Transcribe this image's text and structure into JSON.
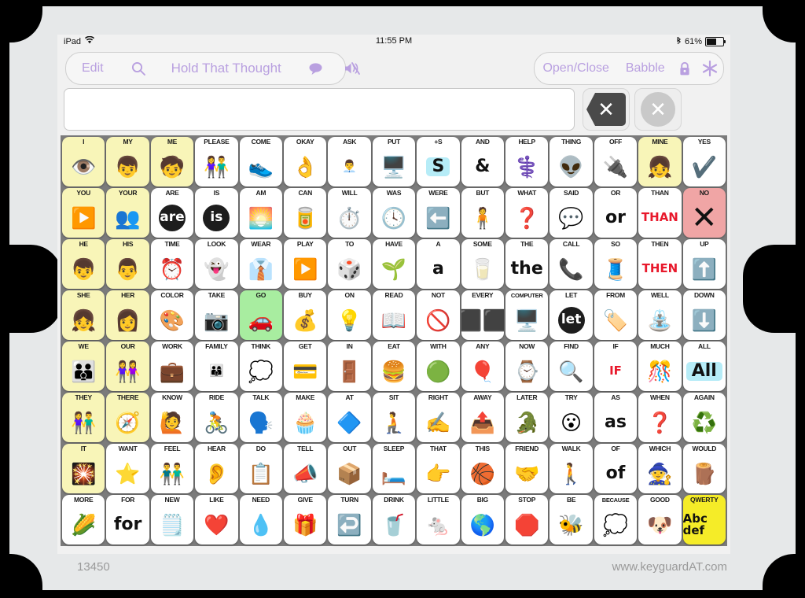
{
  "statusbar": {
    "device": "iPad",
    "wifi_icon": "wifi-icon",
    "time": "11:55 PM",
    "bluetooth_icon": "bluetooth-icon",
    "battery_percent": "61%",
    "battery_icon": "battery-icon"
  },
  "toolbar": {
    "edit_label": "Edit",
    "search_icon": "search-icon",
    "title": "Hold That Thought",
    "speech_bubble_icon": "speech-bubble-icon",
    "mute_icon": "mute-speaker-icon",
    "open_close_label": "Open/Close",
    "babble_label": "Babble",
    "lock_icon": "lock-icon",
    "settings_icon": "asterisk-settings-icon",
    "accent_color": "#b9a0e0"
  },
  "message_bar": {
    "text": "",
    "placeholder": "",
    "backspace_button": "backspace-clear-button",
    "clear_all_button": "clear-all-button",
    "backspace_glyph": "✕",
    "clear_glyph": "✕"
  },
  "grid": {
    "rows": 8,
    "columns": 15,
    "colors": {
      "yellow": "#f8f5b8",
      "green": "#a8eda0",
      "red": "#f0a5a5",
      "bright_yellow": "#f5ec28",
      "white": "#ffffff",
      "grid_background": "#7b7b7b"
    },
    "cells": [
      [
        {
          "label": "I",
          "art": "👁️",
          "bg": "yellow"
        },
        {
          "label": "MY",
          "art": "👦",
          "bg": "yellow"
        },
        {
          "label": "ME",
          "art": "🧒",
          "bg": "yellow"
        },
        {
          "label": "PLEASE",
          "art": "👫",
          "bg": "white"
        },
        {
          "label": "COME",
          "art": "👟",
          "bg": "white"
        },
        {
          "label": "OKAY",
          "art": "👌",
          "bg": "white"
        },
        {
          "label": "ASK",
          "art": "👨‍💼",
          "bg": "white"
        },
        {
          "label": "PUT",
          "art": "🖥️",
          "bg": "white"
        },
        {
          "label": "+S",
          "art": "S",
          "art_type": "chip",
          "bg": "white"
        },
        {
          "label": "AND",
          "art": "&",
          "art_type": "text",
          "bg": "white"
        },
        {
          "label": "HELP",
          "art": "⚕️",
          "bg": "white"
        },
        {
          "label": "THING",
          "art": "👽",
          "bg": "white"
        },
        {
          "label": "OFF",
          "art": "🔌",
          "bg": "white"
        },
        {
          "label": "MINE",
          "art": "👧",
          "bg": "yellow"
        },
        {
          "label": "YES",
          "art": "✔️",
          "bg": "white"
        }
      ],
      [
        {
          "label": "YOU",
          "art": "▶️",
          "bg": "yellow"
        },
        {
          "label": "YOUR",
          "art": "👥",
          "bg": "yellow"
        },
        {
          "label": "ARE",
          "art": "are",
          "art_type": "black",
          "bg": "white"
        },
        {
          "label": "IS",
          "art": "is",
          "art_type": "black",
          "bg": "white"
        },
        {
          "label": "AM",
          "art": "🌅",
          "bg": "white"
        },
        {
          "label": "CAN",
          "art": "🥫",
          "bg": "white"
        },
        {
          "label": "WILL",
          "art": "⏱️",
          "bg": "white"
        },
        {
          "label": "WAS",
          "art": "🕓",
          "bg": "white"
        },
        {
          "label": "WERE",
          "art": "⬅️",
          "bg": "white"
        },
        {
          "label": "BUT",
          "art": "🧍",
          "bg": "white"
        },
        {
          "label": "WHAT",
          "art": "❓",
          "bg": "white"
        },
        {
          "label": "SAID",
          "art": "💬",
          "bg": "white"
        },
        {
          "label": "OR",
          "art": "or",
          "art_type": "text",
          "bg": "white"
        },
        {
          "label": "THAN",
          "art": "THAN",
          "art_type": "red",
          "bg": "white"
        },
        {
          "label": "NO",
          "art": "✕",
          "art_type": "bigx",
          "bg": "red"
        }
      ],
      [
        {
          "label": "HE",
          "art": "👦",
          "bg": "yellow"
        },
        {
          "label": "HIS",
          "art": "👨",
          "bg": "yellow"
        },
        {
          "label": "TIME",
          "art": "⏰",
          "bg": "white"
        },
        {
          "label": "LOOK",
          "art": "👻",
          "bg": "white"
        },
        {
          "label": "WEAR",
          "art": "👔",
          "bg": "white"
        },
        {
          "label": "PLAY",
          "art": "▶️",
          "bg": "white"
        },
        {
          "label": "TO",
          "art": "🎲",
          "bg": "white"
        },
        {
          "label": "HAVE",
          "art": "🌱",
          "bg": "white"
        },
        {
          "label": "A",
          "art": "a",
          "art_type": "text",
          "bg": "white"
        },
        {
          "label": "SOME",
          "art": "🥛",
          "bg": "white"
        },
        {
          "label": "THE",
          "art": "the",
          "art_type": "text",
          "bg": "white"
        },
        {
          "label": "CALL",
          "art": "📞",
          "bg": "white"
        },
        {
          "label": "SO",
          "art": "🧵",
          "bg": "white"
        },
        {
          "label": "THEN",
          "art": "THEN",
          "art_type": "red",
          "bg": "white"
        },
        {
          "label": "UP",
          "art": "⬆️",
          "bg": "white"
        }
      ],
      [
        {
          "label": "SHE",
          "art": "👧",
          "bg": "yellow"
        },
        {
          "label": "HER",
          "art": "👩",
          "bg": "yellow"
        },
        {
          "label": "COLOR",
          "art": "🎨",
          "bg": "white"
        },
        {
          "label": "TAKE",
          "art": "📷",
          "bg": "white"
        },
        {
          "label": "GO",
          "art": "🚗",
          "bg": "green"
        },
        {
          "label": "BUY",
          "art": "💰",
          "bg": "white"
        },
        {
          "label": "ON",
          "art": "💡",
          "bg": "white"
        },
        {
          "label": "READ",
          "art": "📖",
          "bg": "white"
        },
        {
          "label": "NOT",
          "art": "🚫",
          "bg": "white"
        },
        {
          "label": "EVERY",
          "art": "⬛⬛",
          "bg": "white"
        },
        {
          "label": "COMPUTER",
          "art": "🖥️",
          "bg": "white"
        },
        {
          "label": "LET",
          "art": "let",
          "art_type": "black",
          "bg": "white"
        },
        {
          "label": "FROM",
          "art": "🏷️",
          "bg": "white"
        },
        {
          "label": "WELL",
          "art": "⛲",
          "bg": "white"
        },
        {
          "label": "DOWN",
          "art": "⬇️",
          "bg": "white"
        }
      ],
      [
        {
          "label": "WE",
          "art": "👪",
          "bg": "yellow"
        },
        {
          "label": "OUR",
          "art": "👭",
          "bg": "yellow"
        },
        {
          "label": "WORK",
          "art": "💼",
          "bg": "white"
        },
        {
          "label": "FAMILY",
          "art": "👨‍👩‍👦",
          "bg": "white"
        },
        {
          "label": "THINK",
          "art": "💭",
          "bg": "white"
        },
        {
          "label": "GET",
          "art": "💳",
          "bg": "white"
        },
        {
          "label": "IN",
          "art": "🚪",
          "bg": "white"
        },
        {
          "label": "EAT",
          "art": "🍔",
          "bg": "white"
        },
        {
          "label": "WITH",
          "art": "🟢",
          "bg": "white"
        },
        {
          "label": "ANY",
          "art": "🎈",
          "bg": "white"
        },
        {
          "label": "NOW",
          "art": "⌚",
          "bg": "white"
        },
        {
          "label": "FIND",
          "art": "🔍",
          "bg": "white"
        },
        {
          "label": "IF",
          "art": "IF",
          "art_type": "red",
          "bg": "white"
        },
        {
          "label": "MUCH",
          "art": "🎊",
          "bg": "white"
        },
        {
          "label": "ALL",
          "art": "All",
          "art_type": "chip",
          "bg": "white"
        }
      ],
      [
        {
          "label": "THEY",
          "art": "👫",
          "bg": "yellow"
        },
        {
          "label": "THERE",
          "art": "🧭",
          "bg": "yellow"
        },
        {
          "label": "KNOW",
          "art": "🙋",
          "bg": "white"
        },
        {
          "label": "RIDE",
          "art": "🚴",
          "bg": "white"
        },
        {
          "label": "TALK",
          "art": "🗣️",
          "bg": "white"
        },
        {
          "label": "MAKE",
          "art": "🧁",
          "bg": "white"
        },
        {
          "label": "AT",
          "art": "🔷",
          "bg": "white"
        },
        {
          "label": "SIT",
          "art": "🧎",
          "bg": "white"
        },
        {
          "label": "RIGHT",
          "art": "✍️",
          "bg": "white"
        },
        {
          "label": "AWAY",
          "art": "📤",
          "bg": "white"
        },
        {
          "label": "LATER",
          "art": "🐊",
          "bg": "white"
        },
        {
          "label": "TRY",
          "art": "😮",
          "bg": "white"
        },
        {
          "label": "AS",
          "art": "as",
          "art_type": "text",
          "bg": "white"
        },
        {
          "label": "WHEN",
          "art": "❓",
          "bg": "white"
        },
        {
          "label": "AGAIN",
          "art": "♻️",
          "bg": "white"
        }
      ],
      [
        {
          "label": "IT",
          "art": "🎇",
          "bg": "yellow"
        },
        {
          "label": "WANT",
          "art": "⭐",
          "bg": "white"
        },
        {
          "label": "FEEL",
          "art": "👬",
          "bg": "white"
        },
        {
          "label": "HEAR",
          "art": "👂",
          "bg": "white"
        },
        {
          "label": "DO",
          "art": "📋",
          "bg": "white"
        },
        {
          "label": "TELL",
          "art": "📣",
          "bg": "white"
        },
        {
          "label": "OUT",
          "art": "📦",
          "bg": "white"
        },
        {
          "label": "SLEEP",
          "art": "🛏️",
          "bg": "white"
        },
        {
          "label": "THAT",
          "art": "👉",
          "bg": "white"
        },
        {
          "label": "THIS",
          "art": "🏀",
          "bg": "white"
        },
        {
          "label": "FRIEND",
          "art": "🤝",
          "bg": "white"
        },
        {
          "label": "WALK",
          "art": "🚶",
          "bg": "white"
        },
        {
          "label": "OF",
          "art": "of",
          "art_type": "text",
          "bg": "white"
        },
        {
          "label": "WHICH",
          "art": "🧙",
          "bg": "white"
        },
        {
          "label": "WOULD",
          "art": "🪵",
          "bg": "white"
        }
      ],
      [
        {
          "label": "MORE",
          "art": "🌽",
          "bg": "white"
        },
        {
          "label": "FOR",
          "art": "for",
          "art_type": "text",
          "bg": "white"
        },
        {
          "label": "NEW",
          "art": "🗒️",
          "bg": "white"
        },
        {
          "label": "LIKE",
          "art": "❤️",
          "bg": "white"
        },
        {
          "label": "NEED",
          "art": "💧",
          "bg": "white"
        },
        {
          "label": "GIVE",
          "art": "🎁",
          "bg": "white"
        },
        {
          "label": "TURN",
          "art": "↩️",
          "bg": "white"
        },
        {
          "label": "DRINK",
          "art": "🥤",
          "bg": "white"
        },
        {
          "label": "LITTLE",
          "art": "🐁",
          "bg": "white"
        },
        {
          "label": "BIG",
          "art": "🌎",
          "bg": "white"
        },
        {
          "label": "STOP",
          "art": "🛑",
          "bg": "white"
        },
        {
          "label": "BE",
          "art": "🐝",
          "bg": "white"
        },
        {
          "label": "BECAUSE",
          "art": "💭",
          "bg": "white"
        },
        {
          "label": "GOOD",
          "art": "🐶",
          "bg": "white"
        },
        {
          "label": "QWERTY",
          "art": "Abc def",
          "art_type": "text",
          "bg": "bright"
        }
      ]
    ]
  },
  "footer": {
    "model_number": "13450",
    "website": "www.keyguardAT.com"
  }
}
